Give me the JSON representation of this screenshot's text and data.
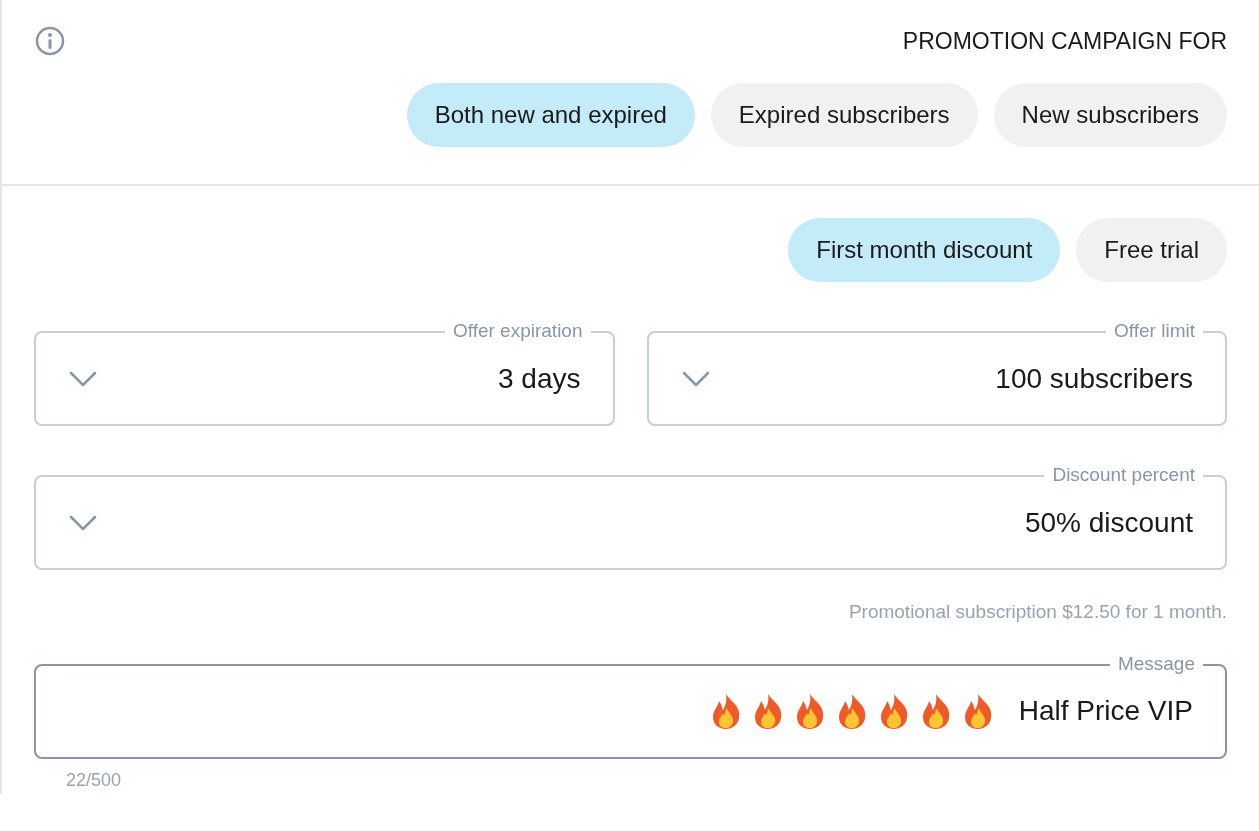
{
  "section_title": "PROMOTION CAMPAIGN FOR",
  "audience_options": [
    {
      "label": "Both new and expired",
      "selected": true
    },
    {
      "label": "Expired subscribers",
      "selected": false
    },
    {
      "label": "New subscribers",
      "selected": false
    }
  ],
  "offer_types": [
    {
      "label": "First month discount",
      "selected": true
    },
    {
      "label": "Free trial",
      "selected": false
    }
  ],
  "selects_row": [
    {
      "label": "Offer expiration",
      "value": "3 days"
    },
    {
      "label": "Offer limit",
      "value": "100 subscribers"
    }
  ],
  "discount_select": {
    "label": "Discount percent",
    "value": "50% discount"
  },
  "helper_text": "Promotional subscription $12.50 for 1 month.",
  "message": {
    "label": "Message",
    "value": "Half Price VIP",
    "counter": "22/500"
  }
}
